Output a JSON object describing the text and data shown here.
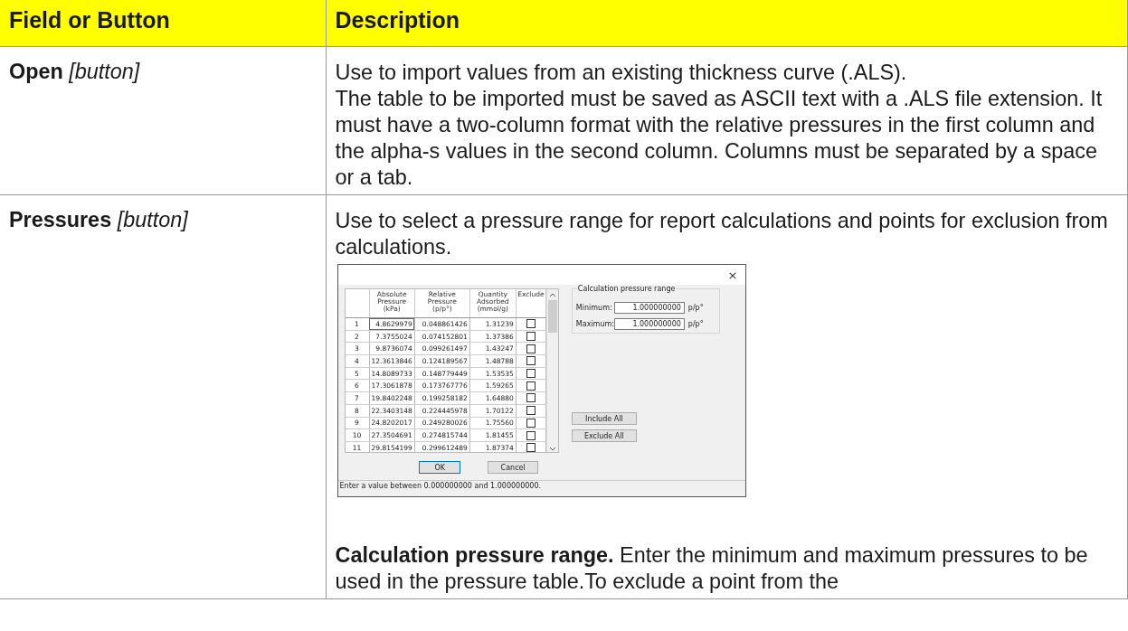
{
  "table": {
    "columns": [
      "Field or Button",
      "Description"
    ],
    "rows": [
      {
        "field": "Open",
        "field_note": "[button]",
        "paragraphs": [
          "Use to import values from an existing thickness curve (.ALS).",
          "The table to be imported must be saved as ASCII text with a .ALS file extension. It must have a two-column format with the relative pressures in the first column and the alpha-s values in the second column. Columns must be separated by a space or a tab."
        ]
      },
      {
        "field": "Pressures",
        "field_note": "[button]",
        "paragraphs": [
          "Use to select a pressure range for report calculations and points for exclusion from calculations."
        ],
        "dialog": {
          "close": "×",
          "grid": {
            "columns": [
              "Absolute\nPressure\n(kPa)",
              "Relative\nPressure\n(p/p°)",
              "Quantity\nAdsorbed\n(mmol/g)",
              "Exclude"
            ],
            "rows": [
              {
                "n": "1",
                "abs": "4.8629979",
                "rel": "0.048861426",
                "qty": "1.31239",
                "checked": false
              },
              {
                "n": "2",
                "abs": "7.3755024",
                "rel": "0.074152801",
                "qty": "1.37386",
                "checked": false
              },
              {
                "n": "3",
                "abs": "9.8736074",
                "rel": "0.099261497",
                "qty": "1.43247",
                "checked": false
              },
              {
                "n": "4",
                "abs": "12.3613846",
                "rel": "0.124189567",
                "qty": "1.48788",
                "checked": false
              },
              {
                "n": "5",
                "abs": "14.8089733",
                "rel": "0.148779449",
                "qty": "1.53535",
                "checked": false
              },
              {
                "n": "6",
                "abs": "17.3061878",
                "rel": "0.173767776",
                "qty": "1.59265",
                "checked": false
              },
              {
                "n": "7",
                "abs": "19.8402248",
                "rel": "0.199258182",
                "qty": "1.64880",
                "checked": false
              },
              {
                "n": "8",
                "abs": "22.3403148",
                "rel": "0.224445978",
                "qty": "1.70122",
                "checked": false
              },
              {
                "n": "9",
                "abs": "24.8202017",
                "rel": "0.249280026",
                "qty": "1.75560",
                "checked": false
              },
              {
                "n": "10",
                "abs": "27.3504691",
                "rel": "0.274815744",
                "qty": "1.81455",
                "checked": false
              },
              {
                "n": "11",
                "abs": "29.8154199",
                "rel": "0.299612489",
                "qty": "1.87374",
                "checked": false
              }
            ]
          },
          "range": {
            "title": "Calculation pressure range",
            "fields": [
              {
                "label": "Minimum:",
                "value": "1.000000000",
                "unit": "p/p°"
              },
              {
                "label": "Maximum:",
                "value": "1.000000000",
                "unit": "p/p°"
              }
            ]
          },
          "side_buttons": [
            "Include All",
            "Exclude All"
          ],
          "buttons": [
            "OK",
            "Cancel"
          ],
          "status": "Enter a value between 0.000000000 and 1.000000000."
        },
        "after": "**Calculation pressure range.** Enter the minimum and maximum pressures to be used in the pressure table.To exclude a point from the"
      }
    ]
  }
}
